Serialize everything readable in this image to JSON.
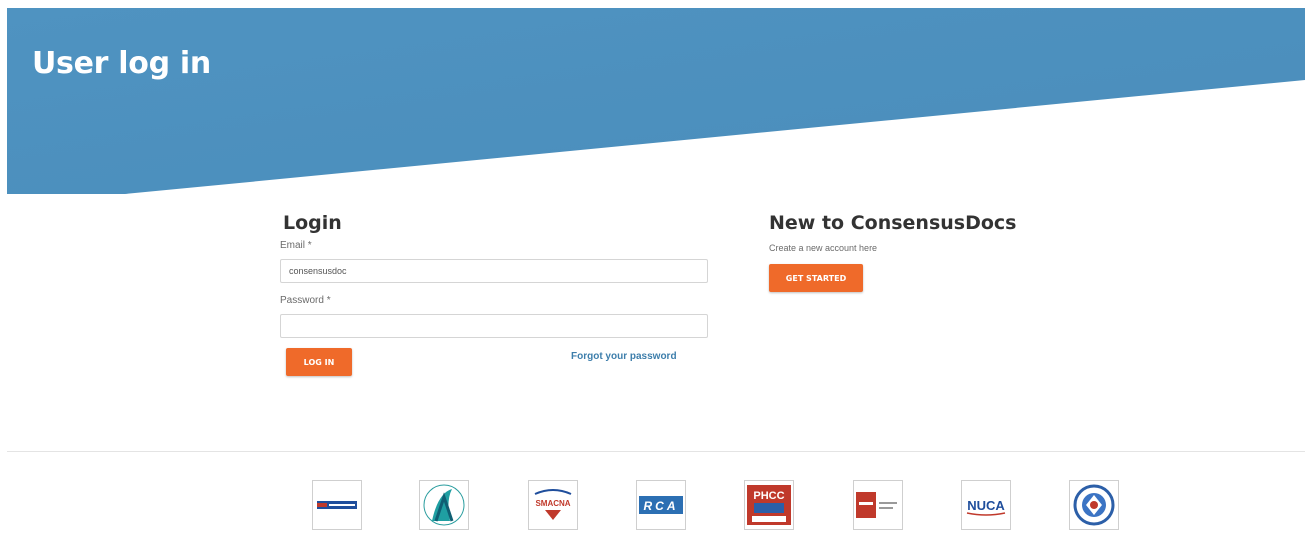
{
  "header": {
    "title": "User log in"
  },
  "login": {
    "heading": "Login",
    "email_label": "Email",
    "email_required": "*",
    "email_value": "consensusdoc",
    "password_label": "Password",
    "password_required": "*",
    "password_value": "",
    "login_button": "LOG IN",
    "forgot_link": "Forgot your password"
  },
  "new_account": {
    "heading": "New to ConsensusDocs",
    "subtitle": "Create a new account here",
    "button": "GET STARTED"
  },
  "colors": {
    "header_blue": "#4d91bf",
    "accent_orange": "#ef6a2a",
    "link_blue": "#3d7eab"
  },
  "partner_logos": [
    {
      "icon": "blue-banner-logo-icon"
    },
    {
      "icon": "teal-wave-a-logo-icon"
    },
    {
      "icon": "smacna-logo-icon",
      "text": "SMACNA"
    },
    {
      "icon": "rca-logo-icon",
      "text": "RCA"
    },
    {
      "icon": "phcc-logo-icon",
      "text": "PHCC"
    },
    {
      "icon": "red-square-logo-icon"
    },
    {
      "icon": "nuca-logo-icon",
      "text": "NUCA"
    },
    {
      "icon": "circular-seal-logo-icon"
    }
  ]
}
